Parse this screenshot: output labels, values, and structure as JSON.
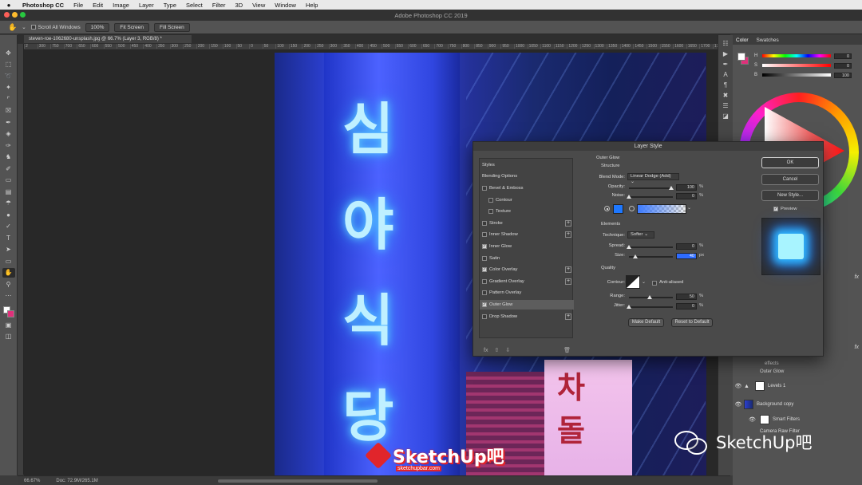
{
  "menubar": {
    "apple": "",
    "app": "Photoshop CC",
    "items": [
      "File",
      "Edit",
      "Image",
      "Layer",
      "Type",
      "Select",
      "Filter",
      "3D",
      "View",
      "Window",
      "Help"
    ]
  },
  "titlebar": {
    "title": "Adobe Photoshop CC 2019"
  },
  "options": {
    "scroll_all": "Scroll All Windows",
    "zoom": "100%",
    "fit_screen": "Fit Screen",
    "fill_screen": "Fill Screen"
  },
  "document": {
    "tab": "steven-roe-1062680-unsplash.jpg @ 66.7% (Layer 3, RGB/8) *",
    "ruler_labels": [
      "2",
      "300",
      "750",
      "700",
      "650",
      "600",
      "550",
      "500",
      "450",
      "400",
      "350",
      "300",
      "250",
      "200",
      "150",
      "100",
      "50",
      "0",
      "50",
      "100",
      "150",
      "200",
      "250",
      "300",
      "350",
      "400",
      "450",
      "500",
      "550",
      "600",
      "650",
      "700",
      "750",
      "800",
      "850",
      "900",
      "950",
      "1000",
      "1050",
      "1100",
      "1150",
      "1200",
      "1250",
      "1300",
      "1350",
      "1400",
      "1450",
      "1500",
      "1550",
      "1600",
      "1650",
      "1700",
      "1750"
    ],
    "hangul": [
      "심",
      "야",
      "식",
      "당"
    ],
    "hangul_sign2": [
      "차",
      "돌"
    ]
  },
  "status": {
    "zoom": "66.67%",
    "doc": "Doc: 72.9M/265.1M"
  },
  "right_panels": {
    "tabs": [
      "Color",
      "Swatches"
    ],
    "sliders": [
      {
        "label": "H",
        "value": "0",
        "unit": "°"
      },
      {
        "label": "S",
        "value": "0",
        "unit": "%"
      },
      {
        "label": "B",
        "value": "100",
        "unit": "%"
      }
    ],
    "layers": [
      {
        "name": "effects"
      },
      {
        "name": "Outer Glow"
      },
      {
        "name": "Levels 1"
      },
      {
        "name": "Background copy"
      },
      {
        "name": "Smart Filters"
      },
      {
        "name": "Camera Raw Filter"
      }
    ],
    "fx": "fx"
  },
  "dialog": {
    "title": "Layer Style",
    "styles_header": "Styles",
    "blending_options": "Blending Options",
    "styles": [
      {
        "label": "Bevel & Emboss",
        "checked": false,
        "indent": false,
        "plus": false
      },
      {
        "label": "Contour",
        "checked": false,
        "indent": true,
        "plus": false
      },
      {
        "label": "Texture",
        "checked": false,
        "indent": true,
        "plus": false
      },
      {
        "label": "Stroke",
        "checked": false,
        "indent": false,
        "plus": true
      },
      {
        "label": "Inner Shadow",
        "checked": false,
        "indent": false,
        "plus": true
      },
      {
        "label": "Inner Glow",
        "checked": true,
        "indent": false,
        "plus": false
      },
      {
        "label": "Satin",
        "checked": false,
        "indent": false,
        "plus": false
      },
      {
        "label": "Color Overlay",
        "checked": true,
        "indent": false,
        "plus": true
      },
      {
        "label": "Gradient Overlay",
        "checked": false,
        "indent": false,
        "plus": true
      },
      {
        "label": "Pattern Overlay",
        "checked": false,
        "indent": false,
        "plus": false
      },
      {
        "label": "Outer Glow",
        "checked": true,
        "indent": false,
        "plus": false,
        "selected": true
      },
      {
        "label": "Drop Shadow",
        "checked": false,
        "indent": false,
        "plus": true
      }
    ],
    "section": "Outer Glow",
    "structure": "Structure",
    "blend_mode_label": "Blend Mode:",
    "blend_mode_value": "Linear Dodge (Add)",
    "opacity_label": "Opacity:",
    "opacity_value": "100",
    "noise_label": "Noise:",
    "noise_value": "0",
    "elements": "Elements",
    "technique_label": "Technique:",
    "technique_value": "Softer",
    "spread_label": "Spread:",
    "spread_value": "0",
    "size_label": "Size:",
    "size_value": "40",
    "quality": "Quality",
    "contour_label": "Contour:",
    "anti_aliased": "Anti-aliased",
    "range_label": "Range:",
    "range_value": "50",
    "jitter_label": "Jitter:",
    "jitter_value": "0",
    "percent": "%",
    "px": "px",
    "make_default": "Make Default",
    "reset_default": "Reset to Default",
    "ok": "OK",
    "cancel": "Cancel",
    "new_style": "New Style...",
    "preview": "Preview",
    "glow_color": "#1e78ff"
  },
  "watermark": {
    "logo": "SketchUp吧",
    "url": "sketchupbar.com",
    "right": "SketchUp吧"
  }
}
